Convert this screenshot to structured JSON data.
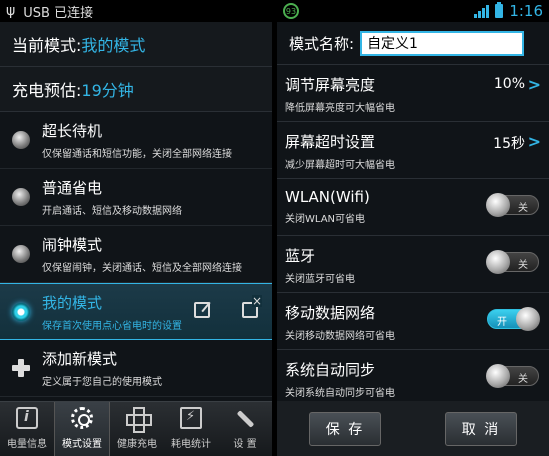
{
  "left": {
    "status": {
      "usb_text": "USB 已连接"
    },
    "current_mode": {
      "label": "当前模式: ",
      "value": "我的模式"
    },
    "charge_estimate": {
      "label": "充电预估: ",
      "value": "19分钟"
    },
    "modes": [
      {
        "title": "超长待机",
        "desc": "仅保留通话和短信功能，关闭全部网络连接"
      },
      {
        "title": "普通省电",
        "desc": "开启通话、短信及移动数据网络"
      },
      {
        "title": "闹钟模式",
        "desc": "仅保留闹钟，关闭通话、短信及全部网络连接"
      },
      {
        "title": "我的模式",
        "desc": "保存首次使用点心省电时的设置"
      }
    ],
    "add_mode": {
      "title": "添加新模式",
      "desc": "定义属于您自己的使用模式"
    },
    "tabs": [
      "电量信息",
      "模式设置",
      "健康充电",
      "耗电统计",
      "设 置"
    ]
  },
  "right": {
    "status": {
      "badge": "93",
      "time": "1:16"
    },
    "mode_name": {
      "label": "模式名称:",
      "value": "自定义1"
    },
    "settings": [
      {
        "title": "调节屏幕亮度",
        "desc": "降低屏幕亮度可大幅省电",
        "value": "10%"
      },
      {
        "title": "屏幕超时设置",
        "desc": "减少屏幕超时可大幅省电",
        "value": "15秒"
      },
      {
        "title": "WLAN(Wifi)",
        "desc": "关闭WLAN可省电",
        "toggle": "关"
      },
      {
        "title": "蓝牙",
        "desc": "关闭蓝牙可省电",
        "toggle": "关"
      },
      {
        "title": "移动数据网络",
        "desc": "关闭移动数据网络可省电",
        "toggle": "开"
      },
      {
        "title": "系统自动同步",
        "desc": "关闭系统自动同步可省电",
        "toggle": "关"
      }
    ],
    "buttons": {
      "save": "保 存",
      "cancel": "取 消"
    }
  }
}
